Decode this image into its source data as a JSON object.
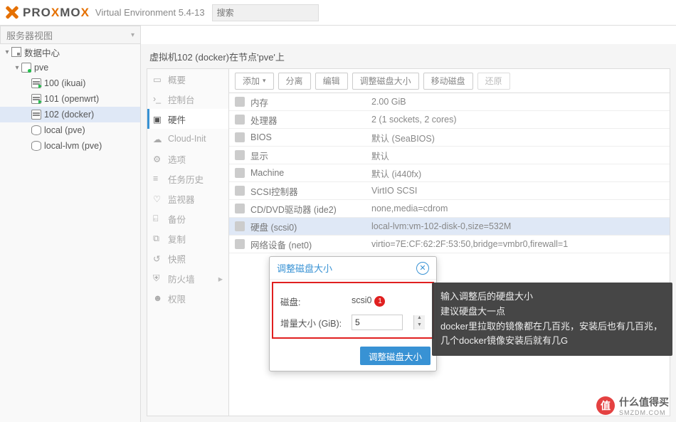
{
  "header": {
    "logo_text_a": "PRO",
    "logo_text_b": "MO",
    "logo_last": "X",
    "product": "Virtual Environment 5.4-13",
    "search_placeholder": "搜索"
  },
  "view_selector": "服务器视图",
  "tree": {
    "root": "数据中心",
    "node": "pve",
    "vms": [
      {
        "label": "100 (ikuai)",
        "running": true
      },
      {
        "label": "101 (openwrt)",
        "running": true
      },
      {
        "label": "102 (docker)",
        "running": false,
        "selected": true
      }
    ],
    "stores": [
      {
        "label": "local (pve)"
      },
      {
        "label": "local-lvm (pve)"
      }
    ]
  },
  "breadcrumb": "虚拟机102 (docker)在节点'pve'上",
  "menu": [
    {
      "label": "概要"
    },
    {
      "label": "控制台"
    },
    {
      "label": "硬件",
      "active": true
    },
    {
      "label": "Cloud-Init"
    },
    {
      "label": "选项"
    },
    {
      "label": "任务历史"
    },
    {
      "label": "监视器"
    },
    {
      "label": "备份"
    },
    {
      "label": "复制"
    },
    {
      "label": "快照"
    },
    {
      "label": "防火墙",
      "expandable": true
    },
    {
      "label": "权限"
    }
  ],
  "toolbar": {
    "add": "添加",
    "detach": "分离",
    "edit": "编辑",
    "resize": "调整磁盘大小",
    "move": "移动磁盘",
    "revert": "还原"
  },
  "hardware": [
    {
      "k": "内存",
      "v": "2.00 GiB"
    },
    {
      "k": "处理器",
      "v": "2 (1 sockets, 2 cores)"
    },
    {
      "k": "BIOS",
      "v": "默认 (SeaBIOS)"
    },
    {
      "k": "显示",
      "v": "默认"
    },
    {
      "k": "Machine",
      "v": "默认 (i440fx)"
    },
    {
      "k": "SCSI控制器",
      "v": "VirtIO SCSI"
    },
    {
      "k": "CD/DVD驱动器 (ide2)",
      "v": "none,media=cdrom"
    },
    {
      "k": "硬盘 (scsi0)",
      "v": "local-lvm:vm-102-disk-0,size=532M",
      "sel": true
    },
    {
      "k": "网络设备 (net0)",
      "v": "virtio=7E:CF:62:2F:53:50,bridge=vmbr0,firewall=1"
    }
  ],
  "dialog": {
    "title": "调整磁盘大小",
    "disk_label": "磁盘:",
    "disk_value": "scsi0",
    "badge": "1",
    "size_label": "增量大小 (GiB):",
    "size_value": "5",
    "button": "调整磁盘大小"
  },
  "annotation": {
    "l1": "输入调整后的硬盘大小",
    "l2": "建议硬盘大一点",
    "l3": "docker里拉取的镜像都在几百兆，安装后也有几百兆，几个docker镜像安装后就有几G"
  },
  "watermark": {
    "badge": "值",
    "text": "什么值得买",
    "sub": "SMZDM.COM"
  }
}
